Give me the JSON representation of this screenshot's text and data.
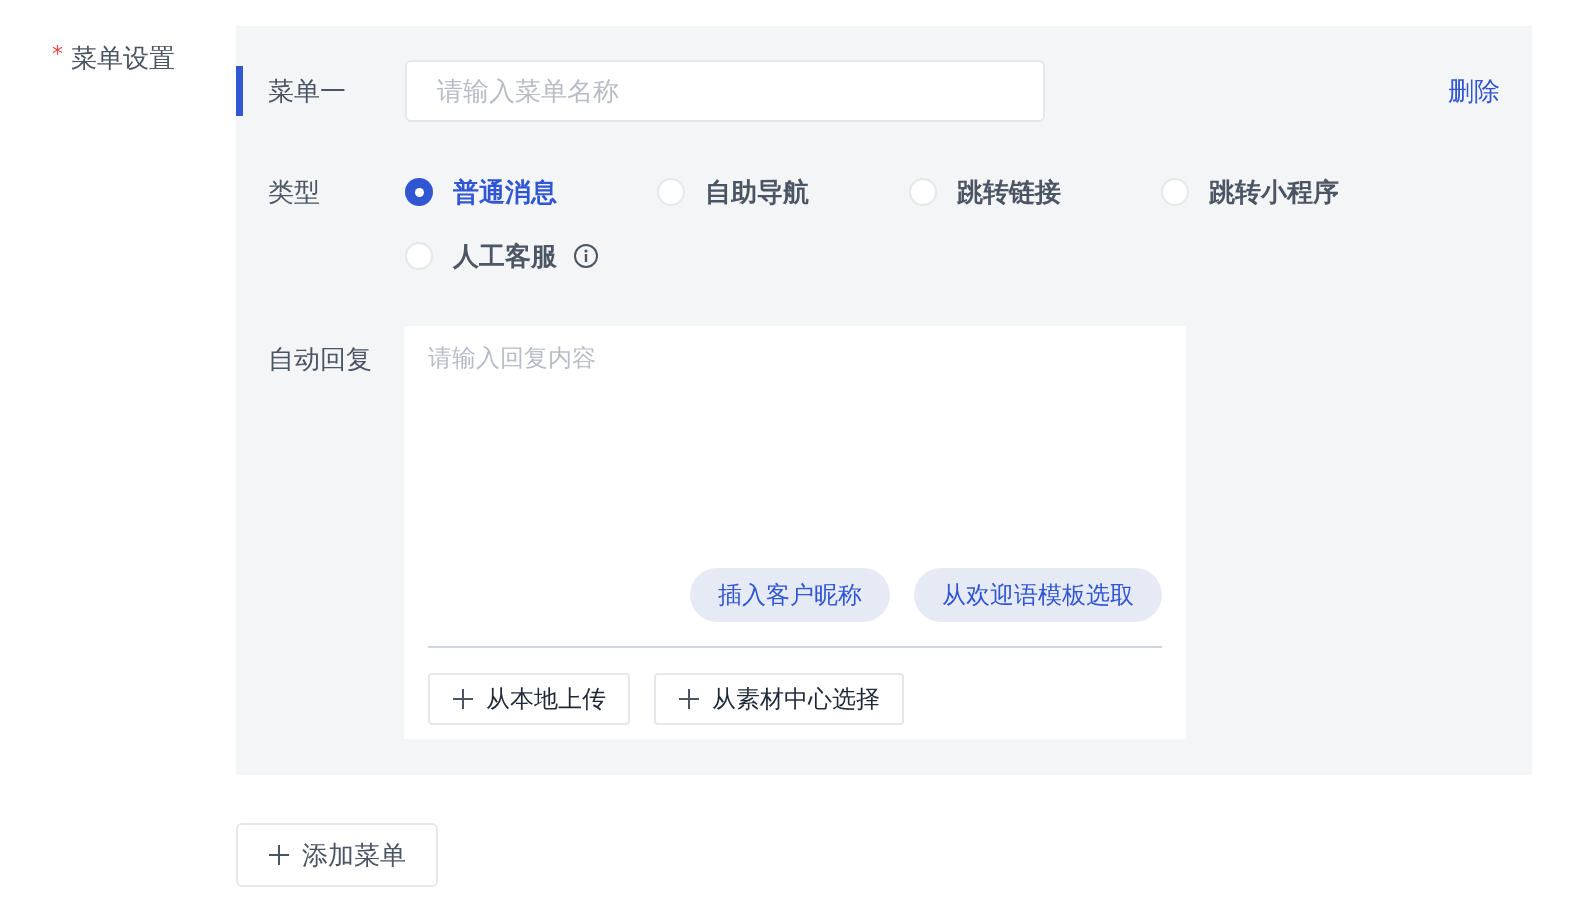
{
  "field_label": {
    "required_mark": "*",
    "text": "菜单设置"
  },
  "menus": [
    {
      "title": "菜单一",
      "name_placeholder": "请输入菜单名称",
      "delete": "删除",
      "type_label": "类型",
      "types": [
        {
          "label": "普通消息",
          "selected": true,
          "info": false
        },
        {
          "label": "自助导航",
          "selected": false,
          "info": false
        },
        {
          "label": "跳转链接",
          "selected": false,
          "info": false
        },
        {
          "label": "跳转小程序",
          "selected": false,
          "info": false
        },
        {
          "label": "人工客服",
          "selected": false,
          "info": true
        }
      ],
      "reply_label": "自动回复",
      "reply_placeholder": "请输入回复内容",
      "insert_buttons": [
        "插入客户昵称",
        "从欢迎语模板选取"
      ],
      "upload_buttons": [
        "从本地上传",
        "从素材中心选择"
      ]
    }
  ],
  "add_button": "添加菜单"
}
